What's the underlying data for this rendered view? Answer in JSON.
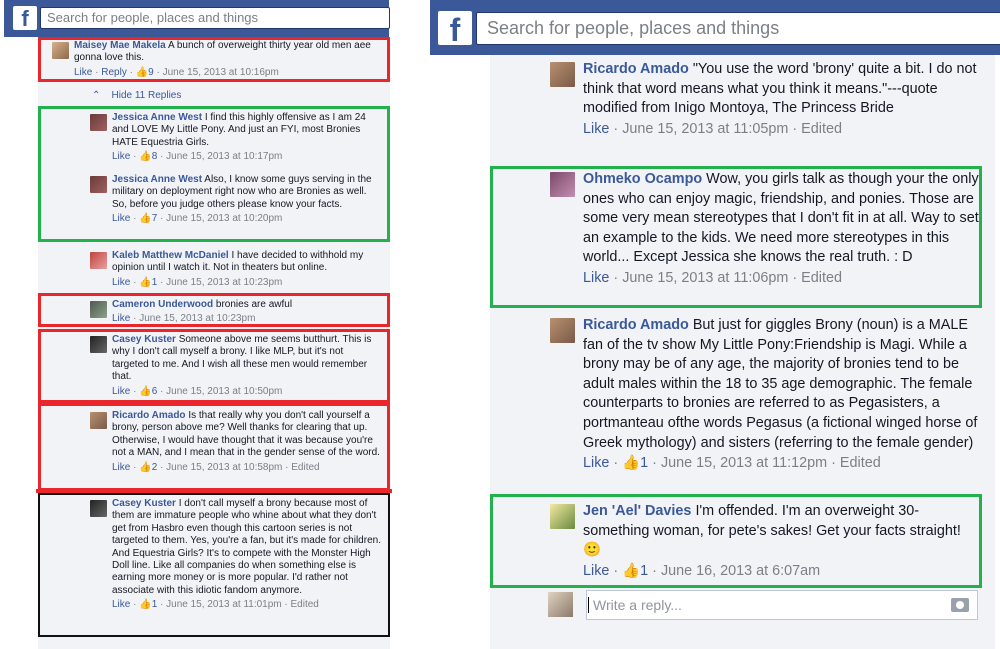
{
  "header": {
    "logo_letter": "f",
    "search_placeholder": "Search for people, places and things"
  },
  "colors": {
    "fb_blue": "#3b5998",
    "author_link": "#3b5998",
    "meta_gray": "#7b7f86",
    "thread_bg": "#f2f3f6",
    "highlight_red": "#e8262c",
    "highlight_green": "#22b14c"
  },
  "left": {
    "hide_replies_label": "Hide 11 Replies",
    "comments": [
      {
        "author": "Maisey Mae Makela",
        "text": "A bunch of overweight thirty year old men aee gonna love this.",
        "like": "Like",
        "reply": "Reply",
        "likes": "9",
        "time": "June 15, 2013 at 10:16pm",
        "edited": ""
      },
      {
        "author": "Jessica Anne West",
        "text": "I find this highly offensive as I am 24 and LOVE My Little Pony. And just an FYI, most Bronies HATE Equestria Girls.",
        "like": "Like",
        "reply": "",
        "likes": "8",
        "time": "June 15, 2013 at 10:17pm",
        "edited": ""
      },
      {
        "author": "Jessica Anne West",
        "text": "Also, I know some guys serving in the military on deployment right now who are Bronies as well. So, before you judge others please know your facts.",
        "like": "Like",
        "reply": "",
        "likes": "7",
        "time": "June 15, 2013 at 10:20pm",
        "edited": ""
      },
      {
        "author": "Kaleb Matthew McDaniel",
        "text": "I have decided to withhold my opinion until I watch it. Not in theaters but online.",
        "like": "Like",
        "reply": "",
        "likes": "1",
        "time": "June 15, 2013 at 10:23pm",
        "edited": ""
      },
      {
        "author": "Cameron Underwood",
        "text": "bronies are awful",
        "like": "Like",
        "reply": "",
        "likes": "",
        "time": "June 15, 2013 at 10:23pm",
        "edited": ""
      },
      {
        "author": "Casey Kuster",
        "text": "Someone above me seems butthurt. This is why I don't call myself a brony. I like MLP, but it's not targeted to me. And I wish all these men would remember that.",
        "like": "Like",
        "reply": "",
        "likes": "6",
        "time": "June 15, 2013 at 10:50pm",
        "edited": ""
      },
      {
        "author": "Ricardo Amado",
        "text": "Is that really why you don't call yourself a brony, person above me? Well thanks for clearing that up. Otherwise, I would have thought that it was because you're not a MAN, and I mean that in the gender sense of the word.",
        "like": "Like",
        "reply": "",
        "likes": "2",
        "time": "June 15, 2013 at 10:58pm",
        "edited": "Edited"
      },
      {
        "author": "Casey Kuster",
        "text": "I don't call myself a brony because most of them are immature people who whine about what they don't get from Hasbro even though this cartoon series is not targeted to them. Yes, you're a fan, but it's made for children. And Equestria Girls? It's to compete with the Monster High Doll line. Like all companies do when something else is earning more money or is more popular. I'd rather not associate with this idiotic fandom anymore.",
        "like": "Like",
        "reply": "",
        "likes": "1",
        "time": "June 15, 2013 at 11:01pm",
        "edited": "Edited"
      }
    ]
  },
  "right": {
    "reply_placeholder": "Write a reply...",
    "comments": [
      {
        "author": "Ricardo Amado",
        "text": "\"You use the word 'brony' quite a bit. I do not think that word means what you think it means.\"---quote modified from Inigo Montoya, The Princess Bride",
        "like": "Like",
        "likes": "",
        "time": "June 15, 2013 at 11:05pm",
        "edited": "Edited"
      },
      {
        "author": "Ohmeko Ocampo",
        "text": "Wow, you girls talk as though your the only ones who can enjoy magic, friendship, and ponies. Those are some very mean stereotypes that I don't fit in at all. Way to set an example to the kids. We need more stereotypes in this world... Except Jessica she knows the real truth. : D",
        "like": "Like",
        "likes": "",
        "time": "June 15, 2013 at 11:06pm",
        "edited": "Edited"
      },
      {
        "author": "Ricardo Amado",
        "text": "But just for giggles Brony (noun) is a MALE fan of the tv show My Little Pony:Friendship is Magi. While a brony may be of any age, the majority of bronies tend to be adult males within the 18 to 35 age demographic. The female counterparts to bronies are referred to as Pegasisters, a portmanteau ofthe words Pegasus (a fictional winged horse of Greek mythology) and sisters (referring to the female gender)",
        "like": "Like",
        "likes": "1",
        "time": "June 15, 2013 at 11:12pm",
        "edited": "Edited"
      },
      {
        "author": "Jen 'Ael' Davies",
        "text": "I'm offended. I'm an overweight 30-something woman, for pete's sakes! Get your facts straight!",
        "emoji": "🙂",
        "like": "Like",
        "likes": "1",
        "time": "June 16, 2013 at 6:07am",
        "edited": ""
      }
    ]
  }
}
